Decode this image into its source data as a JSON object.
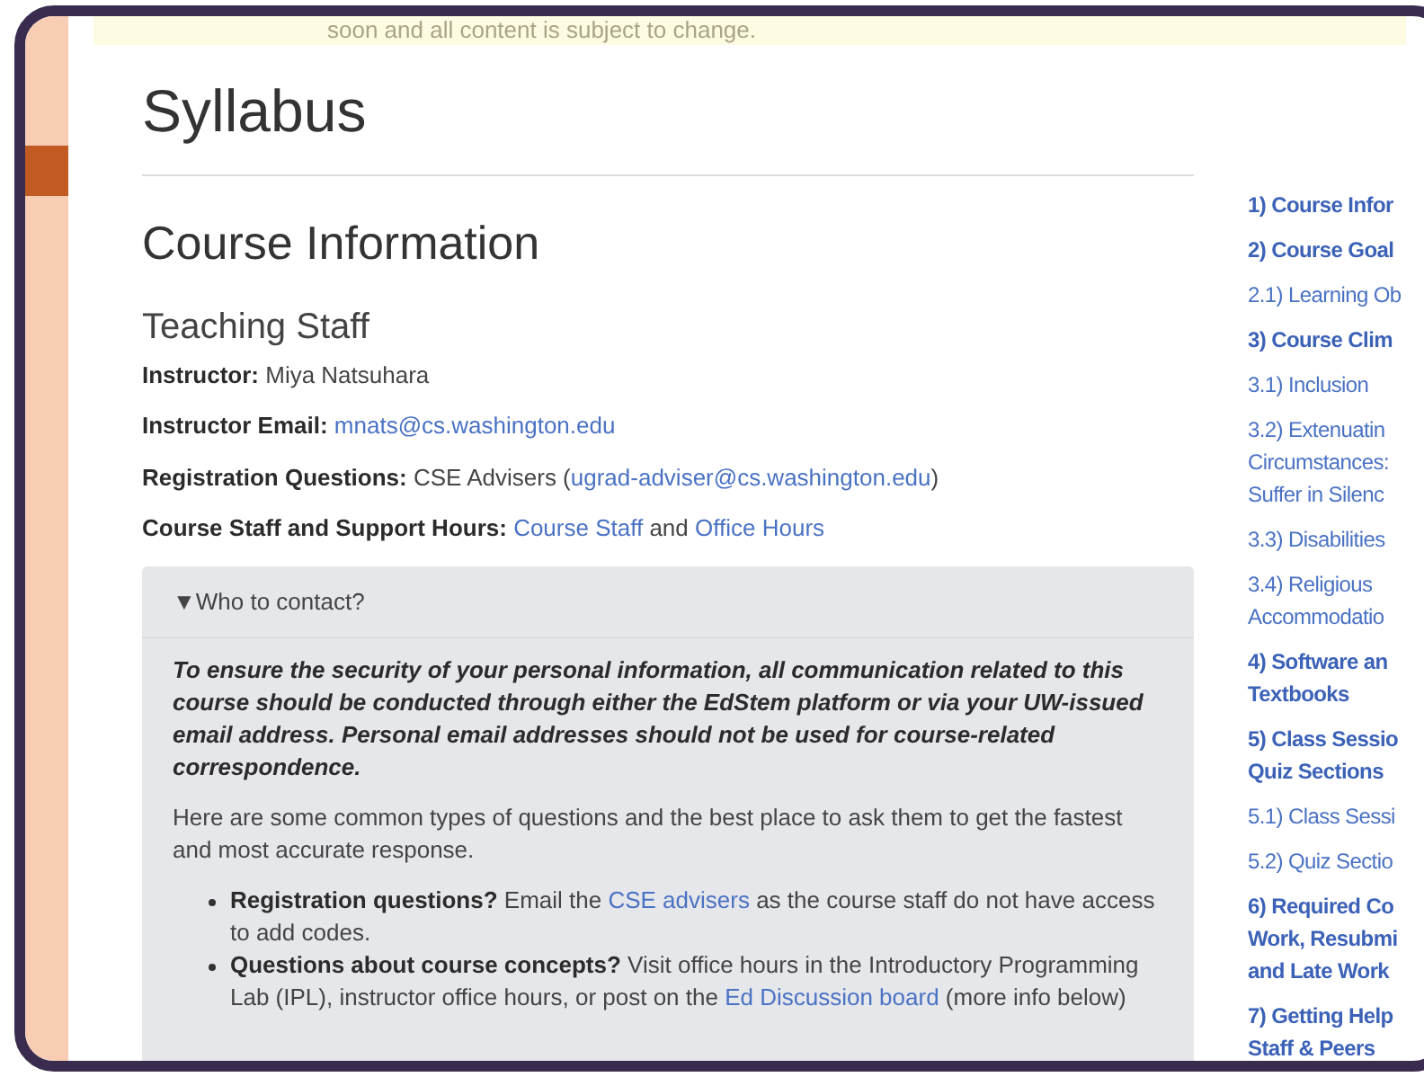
{
  "banner": {
    "text": "soon and all content is subject to change."
  },
  "page_title": "Syllabus",
  "section_title": "Course Information",
  "subsection_title": "Teaching Staff",
  "staff_lines": [
    {
      "segments": [
        {
          "kind": "bold",
          "text": "Instructor:"
        },
        {
          "kind": "plain",
          "text": " Miya Natsuhara"
        }
      ]
    },
    {
      "segments": [
        {
          "kind": "bold",
          "text": "Instructor Email: "
        },
        {
          "kind": "link",
          "text": "mnats@cs.washington.edu"
        }
      ]
    },
    {
      "segments": [
        {
          "kind": "bold",
          "text": "Registration Questions:"
        },
        {
          "kind": "plain",
          "text": " CSE Advisers ("
        },
        {
          "kind": "link",
          "text": "ugrad-adviser@cs.washington.edu"
        },
        {
          "kind": "plain",
          "text": ")"
        }
      ]
    },
    {
      "segments": [
        {
          "kind": "bold",
          "text": "Course Staff and Support Hours: "
        },
        {
          "kind": "link",
          "text": "Course Staff"
        },
        {
          "kind": "plain",
          "text": " and "
        },
        {
          "kind": "link",
          "text": "Office Hours"
        }
      ]
    }
  ],
  "details": {
    "marker": "▼",
    "summary": "Who to contact?",
    "expanded": true,
    "notice": "To ensure the security of your personal information, all communication related to this course should be conducted through either the EdStem platform or via your UW-issued email address. Personal email addresses should not be used for course-related correspondence.",
    "intro": "Here are some common types of questions and the best place to ask them to get the fastest and most accurate response.",
    "bullets": [
      {
        "segments": [
          {
            "kind": "bold",
            "text": "Registration questions?"
          },
          {
            "kind": "plain",
            "text": " Email the "
          },
          {
            "kind": "link",
            "text": "CSE advisers"
          },
          {
            "kind": "plain",
            "text": " as the course staff do not have access to add codes."
          }
        ]
      },
      {
        "segments": [
          {
            "kind": "bold",
            "text": "Questions about course concepts?"
          },
          {
            "kind": "plain",
            "text": " Visit office hours in the Introductory Programming Lab (IPL), instructor office hours, or post on the "
          },
          {
            "kind": "link",
            "text": "Ed Discussion board"
          },
          {
            "kind": "plain",
            "text": " (more info below)"
          }
        ]
      }
    ]
  },
  "toc": [
    {
      "lines": [
        "1) Course Infor"
      ]
    },
    {
      "lines": [
        "2) Course Goal"
      ],
      "children": [
        {
          "lines": [
            "2.1) Learning Ob"
          ]
        }
      ]
    },
    {
      "lines": [
        "3) Course Clim"
      ],
      "children": [
        {
          "lines": [
            "3.1) Inclusion"
          ]
        },
        {
          "lines": [
            "3.2) Extenuatin",
            "Circumstances:",
            "Suffer in Silenc"
          ]
        },
        {
          "lines": [
            "3.3) Disabilities"
          ]
        },
        {
          "lines": [
            "3.4) Religious",
            "Accommodatio"
          ]
        }
      ]
    },
    {
      "lines": [
        "4) Software an",
        "Textbooks"
      ]
    },
    {
      "lines": [
        "5) Class Sessio",
        "Quiz Sections"
      ],
      "children": [
        {
          "lines": [
            "5.1) Class Sessi"
          ]
        },
        {
          "lines": [
            "5.2) Quiz Sectio"
          ]
        }
      ]
    },
    {
      "lines": [
        "6) Required Co",
        "Work, Resubmi",
        "and Late Work"
      ]
    },
    {
      "lines": [
        "7) Getting Help",
        "Staff & Peers"
      ]
    }
  ]
}
